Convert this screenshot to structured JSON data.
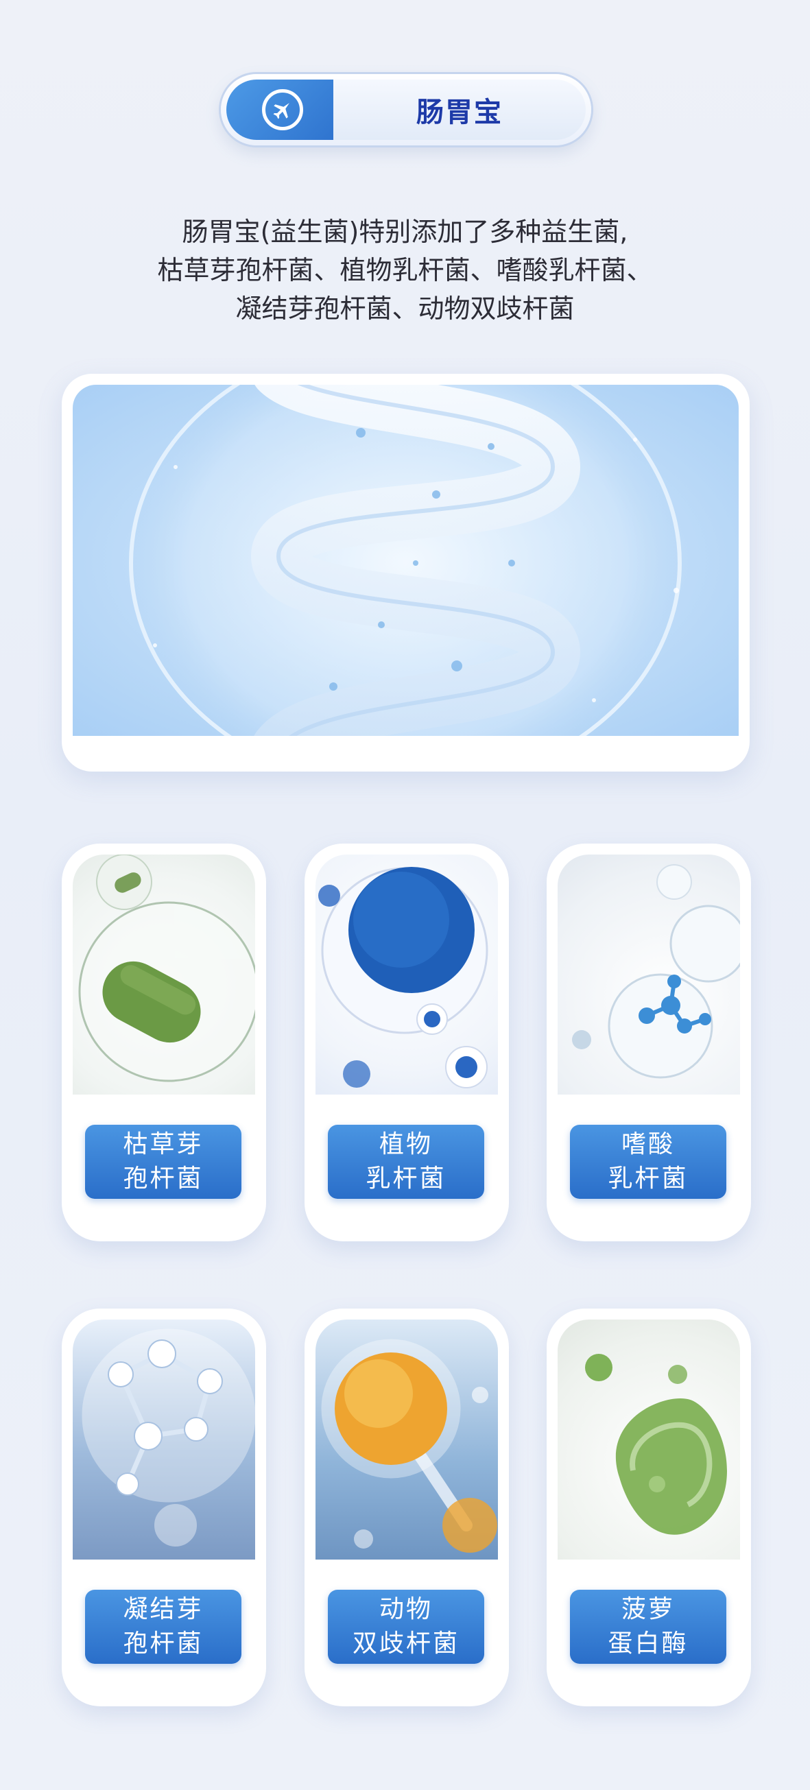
{
  "header": {
    "title": "肠胃宝",
    "icon": "airplane-icon"
  },
  "intro": {
    "line1": "肠胃宝(益生菌)特别添加了多种益生菌,",
    "line2": "枯草芽孢杆菌、植物乳杆菌、嗜酸乳杆菌、",
    "line3": "凝结芽孢杆菌、动物双歧杆菌"
  },
  "products": [
    {
      "line1": "枯草芽",
      "line2": "孢杆菌"
    },
    {
      "line1": "植物",
      "line2": "乳杆菌"
    },
    {
      "line1": "嗜酸",
      "line2": "乳杆菌"
    },
    {
      "line1": "凝结芽",
      "line2": "孢杆菌"
    },
    {
      "line1": "动物",
      "line2": "双歧杆菌"
    },
    {
      "line1": "菠萝",
      "line2": "蛋白酶"
    }
  ],
  "colors": {
    "accent": "#2f74cf",
    "title": "#1d3aa8",
    "background": "#eef1f8"
  }
}
